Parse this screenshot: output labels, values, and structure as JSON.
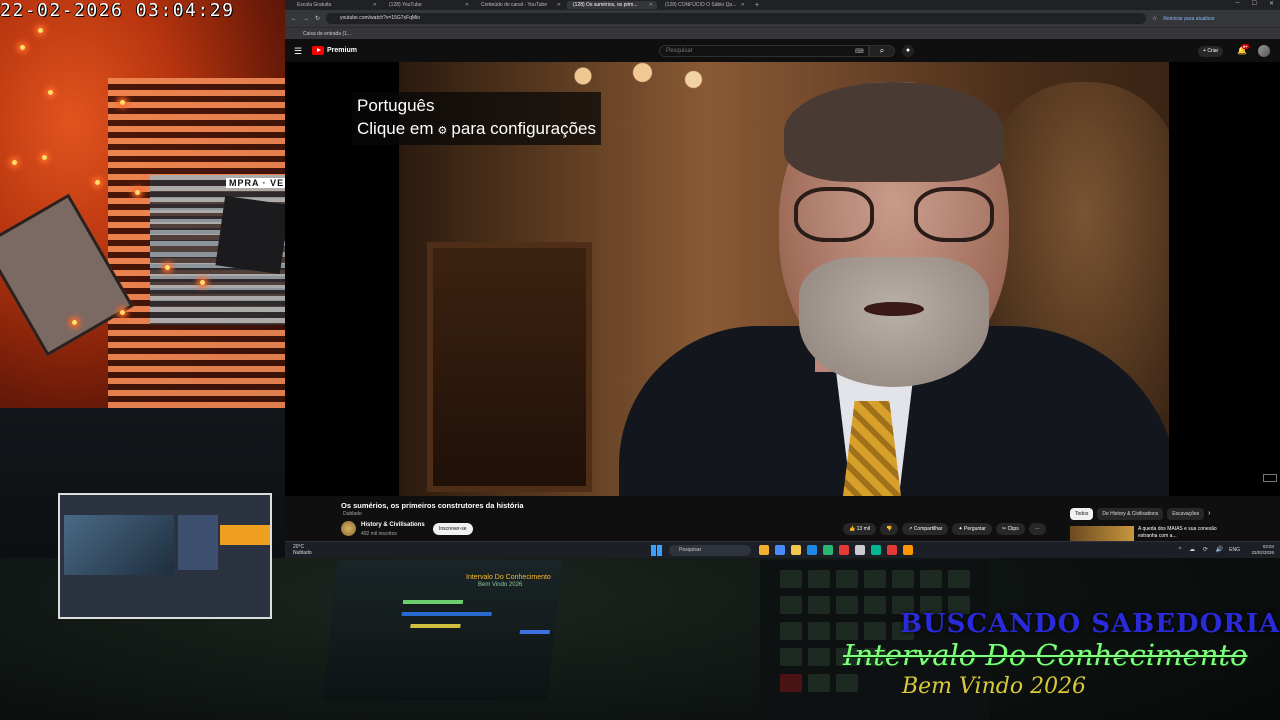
{
  "cam": {
    "timestamp": "22-02-2026 03:04:29",
    "sign_text": "MPRA · VE"
  },
  "browser": {
    "tabs": [
      {
        "label": "Escola Gratuita"
      },
      {
        "label": "(128) YouTube"
      },
      {
        "label": "Conteúdo do canal - YouTube"
      },
      {
        "label": "(128) Os sumérios, os prim..."
      },
      {
        "label": "(128) CONFÚCIO O Sábio Qu..."
      }
    ],
    "url": "youtube.com/watch?v=15G7xFqMio",
    "relaunch": "Reiniciar para atualizar",
    "bookmark": "Caixa de entrada (1..."
  },
  "youtube": {
    "logo": "Premium",
    "search_placeholder": "Pesquisar",
    "create": "Criar",
    "notif_count": "9+",
    "captions": {
      "line1": "Português",
      "line2_pre": "Clique em",
      "line2_post": "para configurações"
    },
    "video_title": "Os sumérios, os primeiros construtores da história",
    "tag": "Dublado",
    "channel": "History & Civilisations",
    "subscribers": "492 mil inscritos",
    "subscribe": "Inscrever-se",
    "actions": {
      "likes": "13 mil",
      "share": "Compartilhar",
      "ask": "Perguntar",
      "clips": "Clips",
      "more": "···"
    },
    "chips": [
      "Todos",
      "De History & Civilisations",
      "Escavações"
    ],
    "related_title": "A queda dos MAIAS e sua conexão estranha com a..."
  },
  "taskbar": {
    "weather_temp": "20°C",
    "weather_desc": "Nublado",
    "search": "Pesquisar",
    "lang": "ENG",
    "time": "03:04",
    "date": "22/02/2026",
    "icon_colors": [
      "#f2b02e",
      "#4a8cff",
      "#f2c94c",
      "#1e88e5",
      "#2bb673",
      "#e53935",
      "#c9cdd2",
      "#00b894",
      "#e53935",
      "#ff9800"
    ]
  },
  "studio": {
    "monitor_title": "Intervalo Do Conhecimento",
    "monitor_sub": "Bem Vindo 2026",
    "overlay_top": "BUSCANDO SABEDORIA",
    "overlay_main": "Intervalo Do Conhecimento",
    "overlay_sub": "Bem Vindo 2026"
  }
}
